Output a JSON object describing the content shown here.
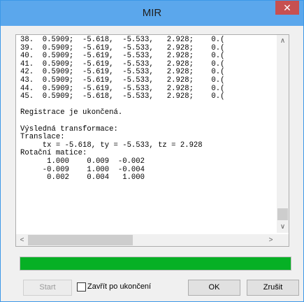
{
  "window": {
    "title": "MIR",
    "close_glyph": "✕"
  },
  "log_lines": [
    "38.  0.5909;  -5.618,  -5.533,   2.928;    0.(",
    "39.  0.5909;  -5.619,  -5.533,   2.928;    0.(",
    "40.  0.5909;  -5.619,  -5.533,   2.928;    0.(",
    "41.  0.5909;  -5.619,  -5.533,   2.928;    0.(",
    "42.  0.5909;  -5.619,  -5.533,   2.928;    0.(",
    "43.  0.5909;  -5.619,  -5.533,   2.928;    0.(",
    "44.  0.5909;  -5.619,  -5.533,   2.928;    0.(",
    "45.  0.5909;  -5.618,  -5.533,   2.928;    0.(",
    "",
    "Registrace je ukončená.",
    "",
    "Výsledná transformace:",
    "Translace:",
    "     tx = -5.618, ty = -5.533, tz = 2.928",
    "Rotační matice:",
    "      1.000    0.009  -0.002",
    "     -0.009    1.000  -0.004",
    "      0.002    0.004   1.000"
  ],
  "scrollbar": {
    "up": "∧",
    "down": "∨",
    "left": "<",
    "right": ">"
  },
  "progress": {
    "value_percent": 100,
    "color": "#06b025"
  },
  "buttons": {
    "start": "Start",
    "ok": "OK",
    "close": "Zrušit"
  },
  "checkbox": {
    "label": "Zavřít po ukončení",
    "checked": false
  }
}
